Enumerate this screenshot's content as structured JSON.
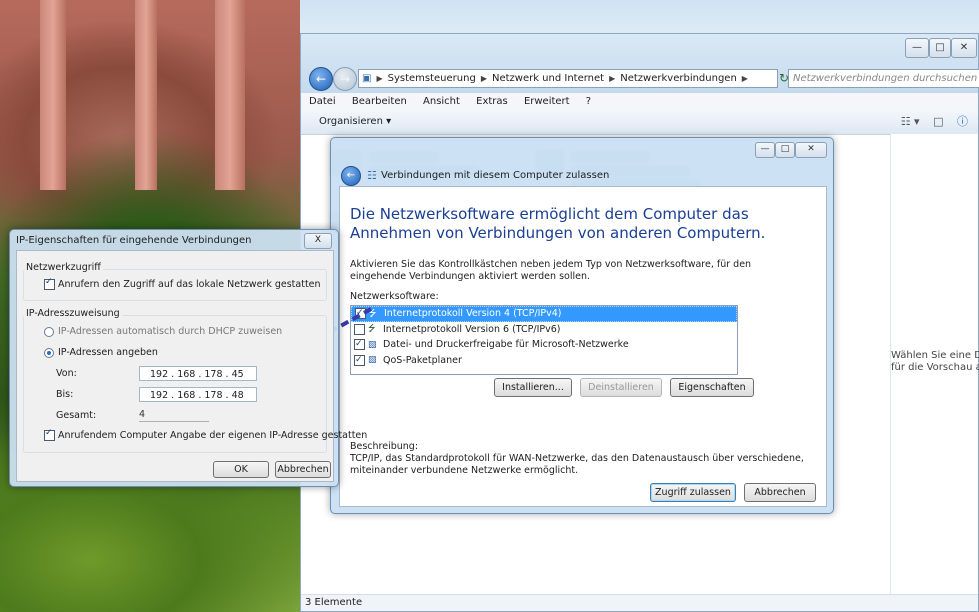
{
  "explorer": {
    "address": [
      "Systemsteuerung",
      "Netzwerk und Internet",
      "Netzwerkverbindungen"
    ],
    "search_placeholder": "Netzwerkverbindungen durchsuchen",
    "menu": [
      "Datei",
      "Bearbeiten",
      "Ansicht",
      "Extras",
      "Erweitert",
      "?"
    ],
    "organize_label": "Organisieren ▾",
    "preview_text_1": "Wählen Sie eine Date",
    "preview_text_2": "für die Vorschau aus",
    "status": "3 Elemente"
  },
  "conn_dialog": {
    "title": "Verbindungen mit diesem Computer zulassen",
    "heading": "Die Netzwerksoftware ermöglicht dem Computer das Annehmen von Verbindungen von anderen Computern.",
    "intro": "Aktivieren Sie das Kontrollkästchen neben jedem Typ von Netzwerksoftware, für den eingehende Verbindungen aktiviert werden sollen.",
    "software_label": "Netzwerksoftware:",
    "software": [
      {
        "label": "Internetprotokoll Version 4 (TCP/IPv4)",
        "checked": true,
        "selected": true
      },
      {
        "label": "Internetprotokoll Version 6 (TCP/IPv6)",
        "checked": false,
        "selected": false
      },
      {
        "label": "Datei- und Druckerfreigabe für Microsoft-Netzwerke",
        "checked": true,
        "selected": false
      },
      {
        "label": "QoS-Paketplaner",
        "checked": true,
        "selected": false
      }
    ],
    "install_btn": "Installieren...",
    "uninstall_btn": "Deinstallieren",
    "properties_btn": "Eigenschaften",
    "description_label": "Beschreibung:",
    "description": "TCP/IP, das Standardprotokoll für WAN-Netzwerke, das den Datenaustausch über verschiedene, miteinander verbundene Netzwerke ermöglicht.",
    "allow_btn": "Zugriff zulassen",
    "cancel_btn": "Abbrechen"
  },
  "ip_dialog": {
    "title": "IP-Eigenschaften für eingehende Verbindungen",
    "close": "X",
    "group1_label": "Netzwerkzugriff",
    "lan_access": "Anrufern den Zugriff auf das lokale Netzwerk gestatten",
    "group2_label": "IP-Adresszuweisung",
    "dhcp_option": "IP-Adressen automatisch durch DHCP zuweisen",
    "manual_option": "IP-Adressen angeben",
    "from_label": "Von:",
    "from_value": "192 . 168 . 178 . 45",
    "to_label": "Bis:",
    "to_value": "192 . 168 . 178 . 48",
    "total_label": "Gesamt:",
    "total_value": "4",
    "own_ip": "Anrufendem Computer Angabe der eigenen IP-Adresse gestatten",
    "ok_btn": "OK",
    "cancel_btn": "Abbrechen"
  },
  "colors": {
    "selection": "#3399ff",
    "heading": "#1a3f93",
    "arrow": "#3a3aa8"
  }
}
